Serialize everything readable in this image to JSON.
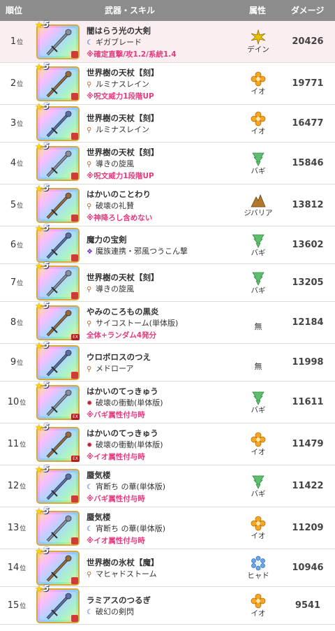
{
  "header": {
    "rank": "順位",
    "weapon": "武器・スキル",
    "attribute": "属性",
    "damage": "ダメージ"
  },
  "rank_suffix": "位",
  "star_rating": "5",
  "rows": [
    {
      "rank": "1",
      "name": "闇はらう光の大剣",
      "skill": "ギガブレード",
      "skill_icon": "crescent-icon",
      "note": "※確定直撃/攻1.2/系統1.4",
      "attr": "デイン",
      "attr_icon": "dein-icon",
      "damage": "20426",
      "highlight": true,
      "ex": false
    },
    {
      "rank": "2",
      "name": "世界樹の天杖【刻】",
      "skill": "ルミナスレイン",
      "skill_icon": "wand-icon",
      "note": "※呪文威力1段階UP",
      "attr": "イオ",
      "attr_icon": "io-icon",
      "damage": "19771",
      "highlight": false,
      "ex": false
    },
    {
      "rank": "3",
      "name": "世界樹の天杖【刻】",
      "skill": "ルミナスレイン",
      "skill_icon": "wand-icon",
      "note": "",
      "attr": "イオ",
      "attr_icon": "io-icon",
      "damage": "16477",
      "highlight": false,
      "ex": false
    },
    {
      "rank": "4",
      "name": "世界樹の天杖【刻】",
      "skill": "導きの旋風",
      "skill_icon": "wand-icon",
      "note": "※呪文威力1段階UP",
      "attr": "バギ",
      "attr_icon": "bagi-icon",
      "damage": "15846",
      "highlight": false,
      "ex": false
    },
    {
      "rank": "5",
      "name": "はかいのことわり",
      "skill": "破壊の礼賛",
      "skill_icon": "wand-icon",
      "note": "※神降ろし含めない",
      "attr": "ジバリア",
      "attr_icon": "jibaria-icon",
      "damage": "13812",
      "highlight": false,
      "ex": false
    },
    {
      "rank": "6",
      "name": "魔力の宝剣",
      "skill": "魔族連携・邪風つうこん撃",
      "skill_icon": "combo-icon",
      "note": "",
      "attr": "バギ",
      "attr_icon": "bagi-icon",
      "damage": "13602",
      "highlight": false,
      "ex": false
    },
    {
      "rank": "7",
      "name": "世界樹の天杖【刻】",
      "skill": "導きの旋風",
      "skill_icon": "wand-icon",
      "note": "",
      "attr": "バギ",
      "attr_icon": "bagi-icon",
      "damage": "13205",
      "highlight": false,
      "ex": false
    },
    {
      "rank": "8",
      "name": "やみのころもの黒炎",
      "skill": "サイコストーム(単体版)",
      "skill_icon": "wand-icon",
      "note": "全体+ランダム4発分",
      "attr": "無",
      "attr_icon": "",
      "damage": "12184",
      "highlight": false,
      "ex": true
    },
    {
      "rank": "9",
      "name": "ウロボロスのつえ",
      "skill": "メドローア",
      "skill_icon": "wand-icon",
      "note": "",
      "attr": "無",
      "attr_icon": "",
      "damage": "11998",
      "highlight": false,
      "ex": false
    },
    {
      "rank": "10",
      "name": "はかいのてっきゅう",
      "skill": "破壊の衝動(単体版)",
      "skill_icon": "gear-icon",
      "note": "※バギ属性付与時",
      "attr": "バギ",
      "attr_icon": "bagi-icon",
      "damage": "11611",
      "highlight": false,
      "ex": true
    },
    {
      "rank": "11",
      "name": "はかいのてっきゅう",
      "skill": "破壊の衝動(単体版)",
      "skill_icon": "gear-icon",
      "note": "※イオ属性付与時",
      "attr": "イオ",
      "attr_icon": "io-icon",
      "damage": "11479",
      "highlight": false,
      "ex": true
    },
    {
      "rank": "12",
      "name": "蜃気楼",
      "skill": "宵断ち の華(単体版)",
      "skill_icon": "crescent-icon",
      "note": "※バギ属性付与時",
      "attr": "バギ",
      "attr_icon": "bagi-icon",
      "damage": "11422",
      "highlight": false,
      "ex": false
    },
    {
      "rank": "13",
      "name": "蜃気楼",
      "skill": "宵断ち の華(単体版)",
      "skill_icon": "crescent-icon",
      "note": "※イオ属性付与時",
      "attr": "イオ",
      "attr_icon": "io-icon",
      "damage": "11209",
      "highlight": false,
      "ex": false
    },
    {
      "rank": "14",
      "name": "世界樹の氷杖【魔】",
      "skill": "マヒャドストーム",
      "skill_icon": "wand-icon",
      "note": "",
      "attr": "ヒャド",
      "attr_icon": "hyado-icon",
      "damage": "10946",
      "highlight": false,
      "ex": false
    },
    {
      "rank": "15",
      "name": "ラミアスのつるぎ",
      "skill": "破幻の剣閃",
      "skill_icon": "crescent-icon",
      "note": "",
      "attr": "イオ",
      "attr_icon": "io-icon",
      "damage": "9541",
      "highlight": false,
      "ex": false
    }
  ],
  "colors": {
    "header_bg": "#8c8c8c",
    "note": "#e33b7e",
    "highlight_row": "#fbeef0",
    "io": "#f5a623",
    "bagi": "#5fbf6f",
    "dein": "#e8c300",
    "jibaria": "#b0782a",
    "hyado": "#6aa7ea"
  }
}
